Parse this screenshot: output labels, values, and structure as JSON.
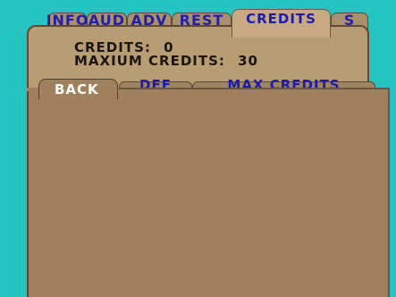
{
  "top_tabs": [
    "INFO",
    "AUD",
    "ADV",
    "REST",
    "CREDITS",
    "S"
  ],
  "credits": {
    "label": "CREDITS:",
    "value": "0"
  },
  "maxium_credits": {
    "label": "MAXIUM CREDITS:",
    "value": "30"
  },
  "lower_tabs": [
    "BACK",
    "DEF",
    "MAX CREDITS"
  ],
  "colors": {
    "background": "#27c2c2",
    "panel": "#b89c74",
    "tab": "#a98f6b",
    "content": "#a0815f",
    "accent_blue": "#1d1ba8"
  }
}
